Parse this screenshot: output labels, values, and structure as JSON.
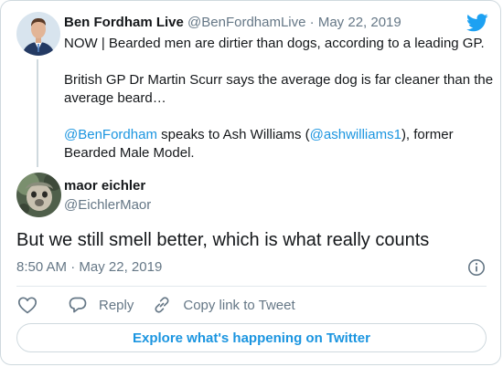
{
  "parent_tweet": {
    "author_name": "Ben Fordham Live",
    "handle": "@BenFordhamLive",
    "separator": " · ",
    "date": "May 22, 2019",
    "lines": [
      "NOW | Bearded men are dirtier than dogs, according to a leading GP.",
      "British GP Dr Martin Scurr says the average dog is far cleaner than the average beard…"
    ],
    "mention_line": {
      "mention1": "@BenFordham",
      "text1": " speaks to Ash Williams (",
      "mention2": "@ashwilliams1",
      "text2": "), former Bearded Male Model."
    }
  },
  "reply_tweet": {
    "author_name": "maor eichler",
    "handle": "@EichlerMaor",
    "text": "But we still smell better, which is what really counts",
    "time": "8:50 AM",
    "separator": " · ",
    "date": "May 22, 2019"
  },
  "actions": {
    "reply_label": "Reply",
    "copy_label": "Copy link to Tweet"
  },
  "explore_label": "Explore what's happening on Twitter",
  "colors": {
    "accent": "#1b95e0",
    "twitter_blue": "#1da1f2",
    "muted": "#657786",
    "border": "#cfd9de"
  },
  "icons": {
    "brand": "twitter-bird-icon",
    "info": "info-icon",
    "like": "heart-icon",
    "reply": "reply-bubble-icon",
    "copy": "link-icon"
  }
}
